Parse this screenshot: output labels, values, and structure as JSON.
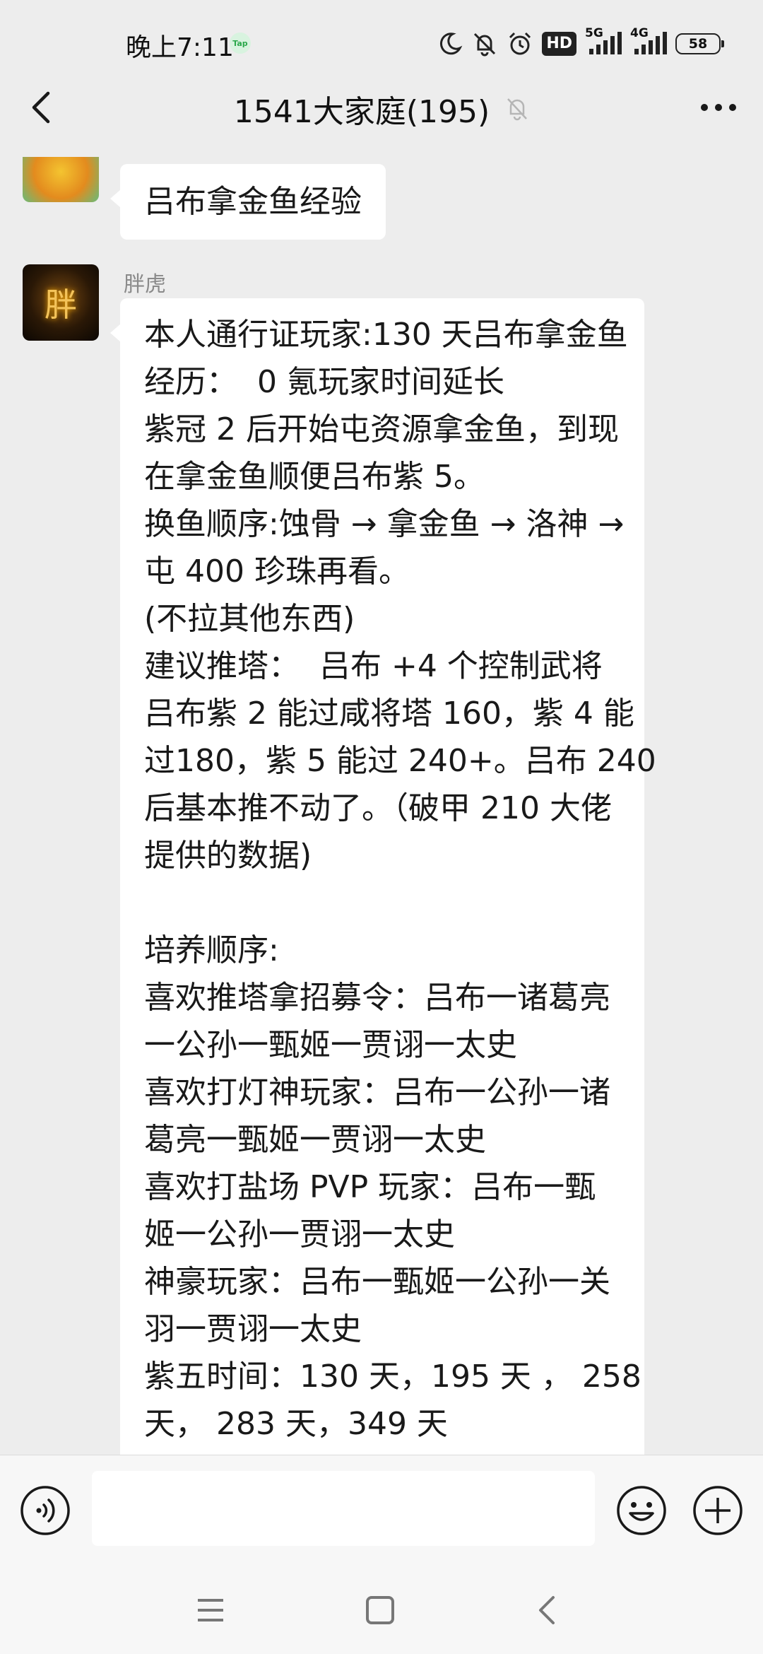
{
  "status_bar": {
    "time": "晚上7:11",
    "tap_badge": "Tap",
    "hd_badge": "HD",
    "net_primary": "5G",
    "net_secondary": "4G",
    "battery": "58",
    "icons": [
      "moon-icon",
      "bell-off-icon",
      "alarm-icon",
      "hd-icon",
      "signal-5g-icon",
      "signal-4g-icon",
      "battery-icon"
    ]
  },
  "header": {
    "title": "1541大家庭(195)",
    "icons": [
      "back-arrow-icon",
      "mute-bell-icon",
      "more-dots-icon"
    ]
  },
  "messages": [
    {
      "sender": "",
      "lines": [
        "吕布拿金鱼经验"
      ]
    },
    {
      "sender": "胖虎",
      "avatar_glyph": "胖",
      "lines": [
        "本人通行证玩家:130 天吕布拿金鱼",
        "经历：  0 氪玩家时间延长",
        "紫冠 2 后开始屯资源拿金鱼，到现",
        "在拿金鱼顺便吕布紫 5。",
        "换鱼顺序:蚀骨 → 拿金鱼 → 洛神 →",
        "屯 400 珍珠再看。",
        "(不拉其他东西)",
        "建议推塔：  吕布 +4 个控制武将",
        "吕布紫 2 能过咸将塔 160，紫 4 能",
        "过180，紫 5 能过 240+。吕布 240",
        "后基本推不动了。（破甲 210 大佬",
        "提供的数据)",
        "",
        "培养顺序:",
        "喜欢推塔拿招募令：吕布一诸葛亮",
        "一公孙一甄姬一贾诩一太史",
        "喜欢打灯神玩家：吕布一公孙一诸",
        "葛亮一甄姬一贾诩一太史",
        "喜欢打盐场 PVP 玩家：吕布一甄",
        "姬一公孙一贾诩一太史",
        "神豪玩家：吕布一甄姬一公孙一关",
        "羽一贾诩一太史",
        "紫五时间：130 天，195 天 ， 258",
        "天， 283 天，349 天"
      ]
    }
  ],
  "input": {
    "placeholder": "",
    "icons": [
      "voice-icon",
      "emoji-icon",
      "plus-icon"
    ]
  },
  "nav": {
    "icons": [
      "menu-icon",
      "home-square-icon",
      "back-chevron-icon"
    ]
  },
  "colors": {
    "background": "#ededed",
    "bubble": "#ffffff",
    "text": "#191919",
    "sender": "#8a8a8a"
  }
}
